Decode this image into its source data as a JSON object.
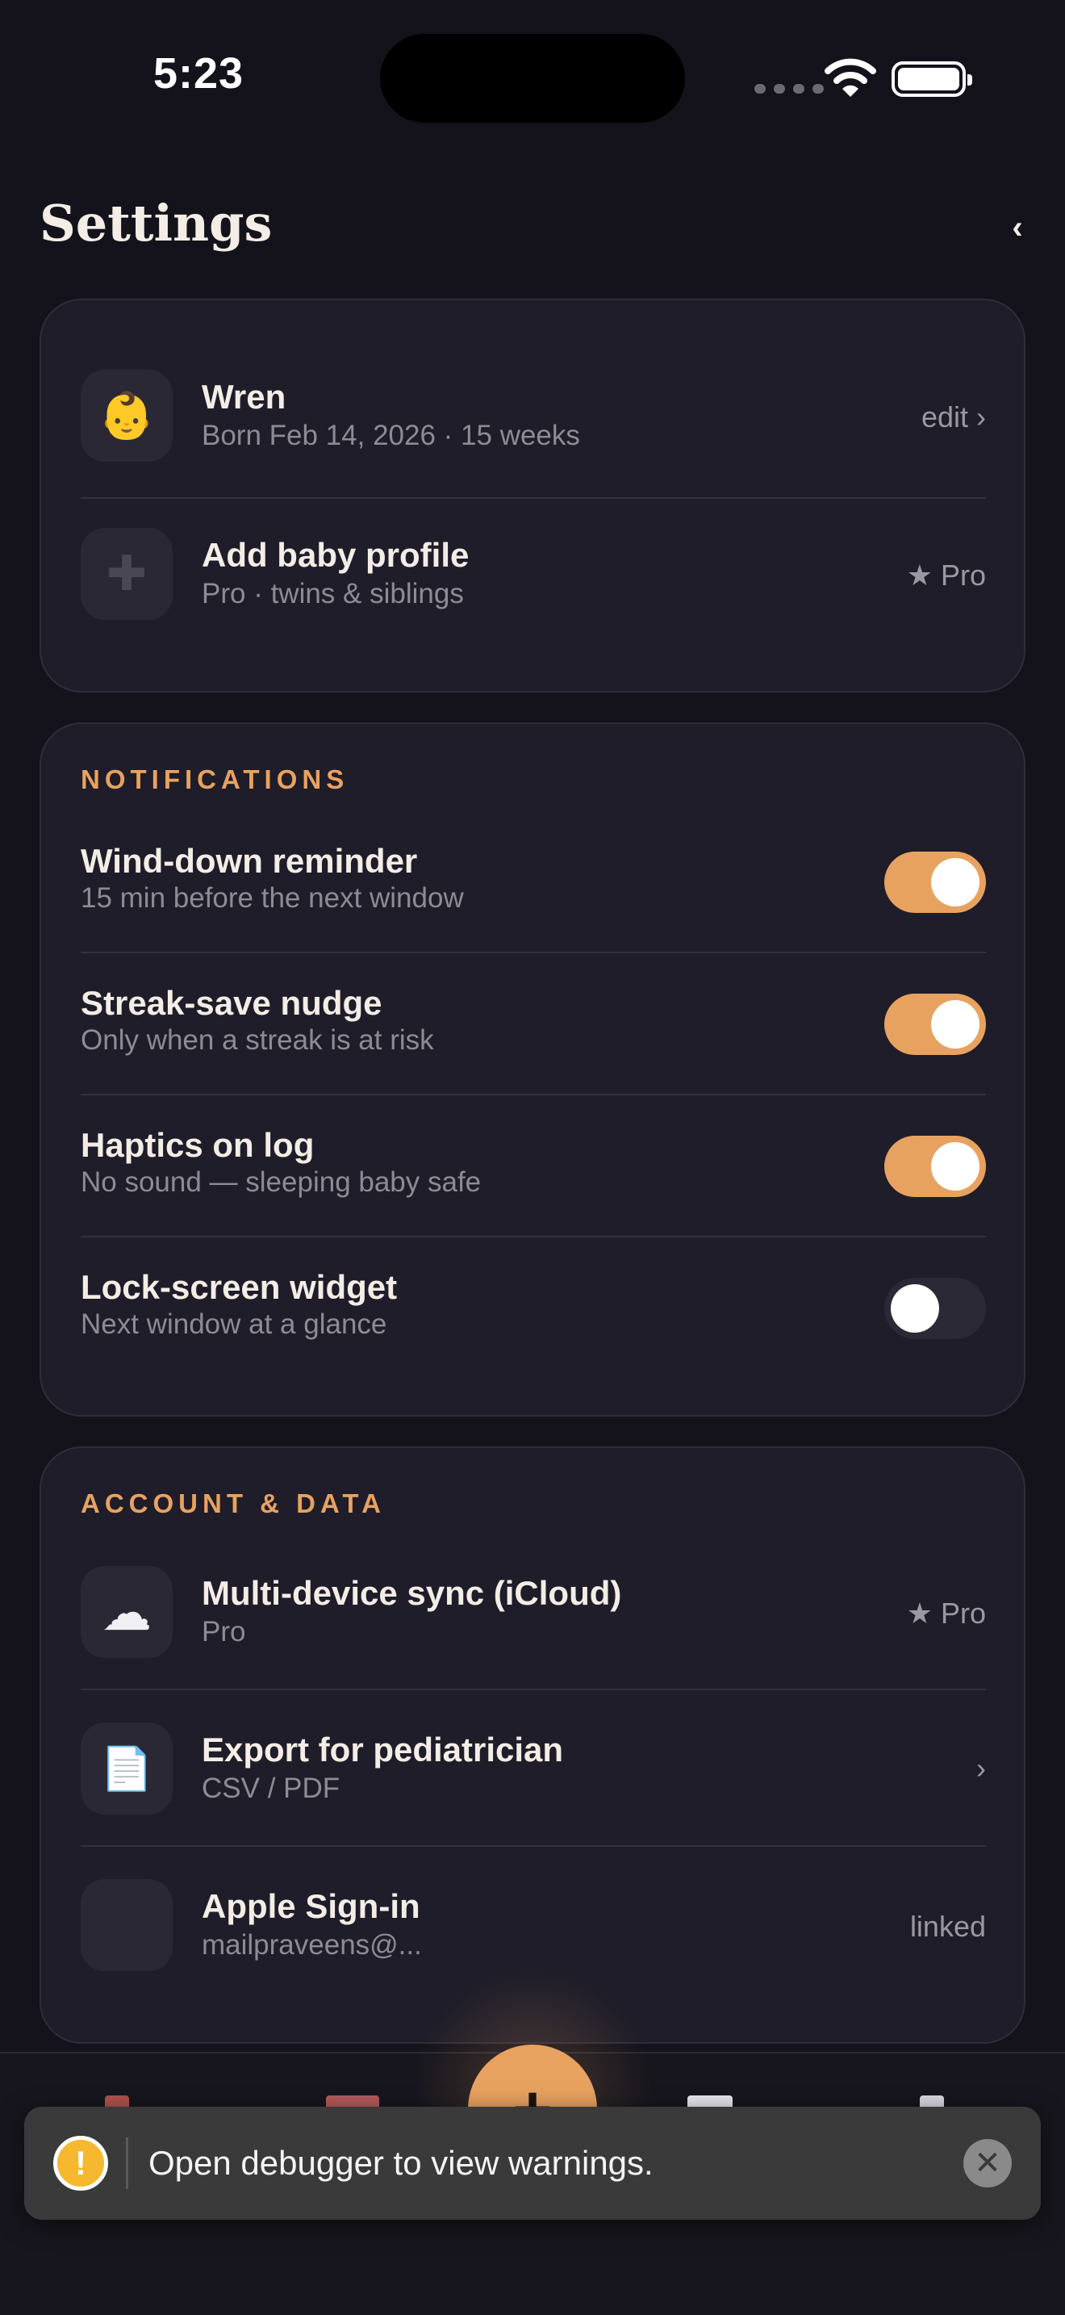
{
  "status_bar": {
    "time": "5:23"
  },
  "header": {
    "title": "Settings",
    "back_glyph": "‹"
  },
  "profiles": [
    {
      "icon": "👶",
      "icon_name": "baby-icon",
      "title": "Wren",
      "subtitle": "Born Feb 14, 2026 · 15 weeks",
      "trailing": "edit ›"
    },
    {
      "icon": "✚",
      "icon_name": "plus-icon",
      "title": "Add baby profile",
      "subtitle": "Pro · twins & siblings",
      "trailing": "★ Pro"
    }
  ],
  "notifications": {
    "label": "NOTIFICATIONS",
    "items": [
      {
        "title": "Wind-down reminder",
        "subtitle": "15 min before the next window",
        "enabled": true
      },
      {
        "title": "Streak-save nudge",
        "subtitle": "Only when a streak is at risk",
        "enabled": true
      },
      {
        "title": "Haptics on log",
        "subtitle": "No sound — sleeping baby safe",
        "enabled": true
      },
      {
        "title": "Lock-screen widget",
        "subtitle": "Next window at a glance",
        "enabled": false
      }
    ]
  },
  "account": {
    "label": "ACCOUNT & DATA",
    "items": [
      {
        "icon": "☁",
        "icon_name": "cloud-icon",
        "title": "Multi-device sync (iCloud)",
        "subtitle": "Pro",
        "trailing": "★ Pro"
      },
      {
        "icon": "📄",
        "icon_name": "document-icon",
        "title": "Export for pediatrician",
        "subtitle": "CSV / PDF",
        "trailing": "›"
      },
      {
        "icon": "",
        "icon_name": "apple-icon",
        "title": "Apple Sign-in",
        "subtitle": "mailpraveens@...",
        "trailing": "linked"
      }
    ]
  },
  "tab_bar": {
    "fab_glyph": "+"
  },
  "toast": {
    "icon": "!",
    "text": "Open debugger to view warnings.",
    "close": "✕"
  },
  "colors": {
    "accent": "#e8a260",
    "background": "#14131b",
    "card": "#1f1d29"
  }
}
